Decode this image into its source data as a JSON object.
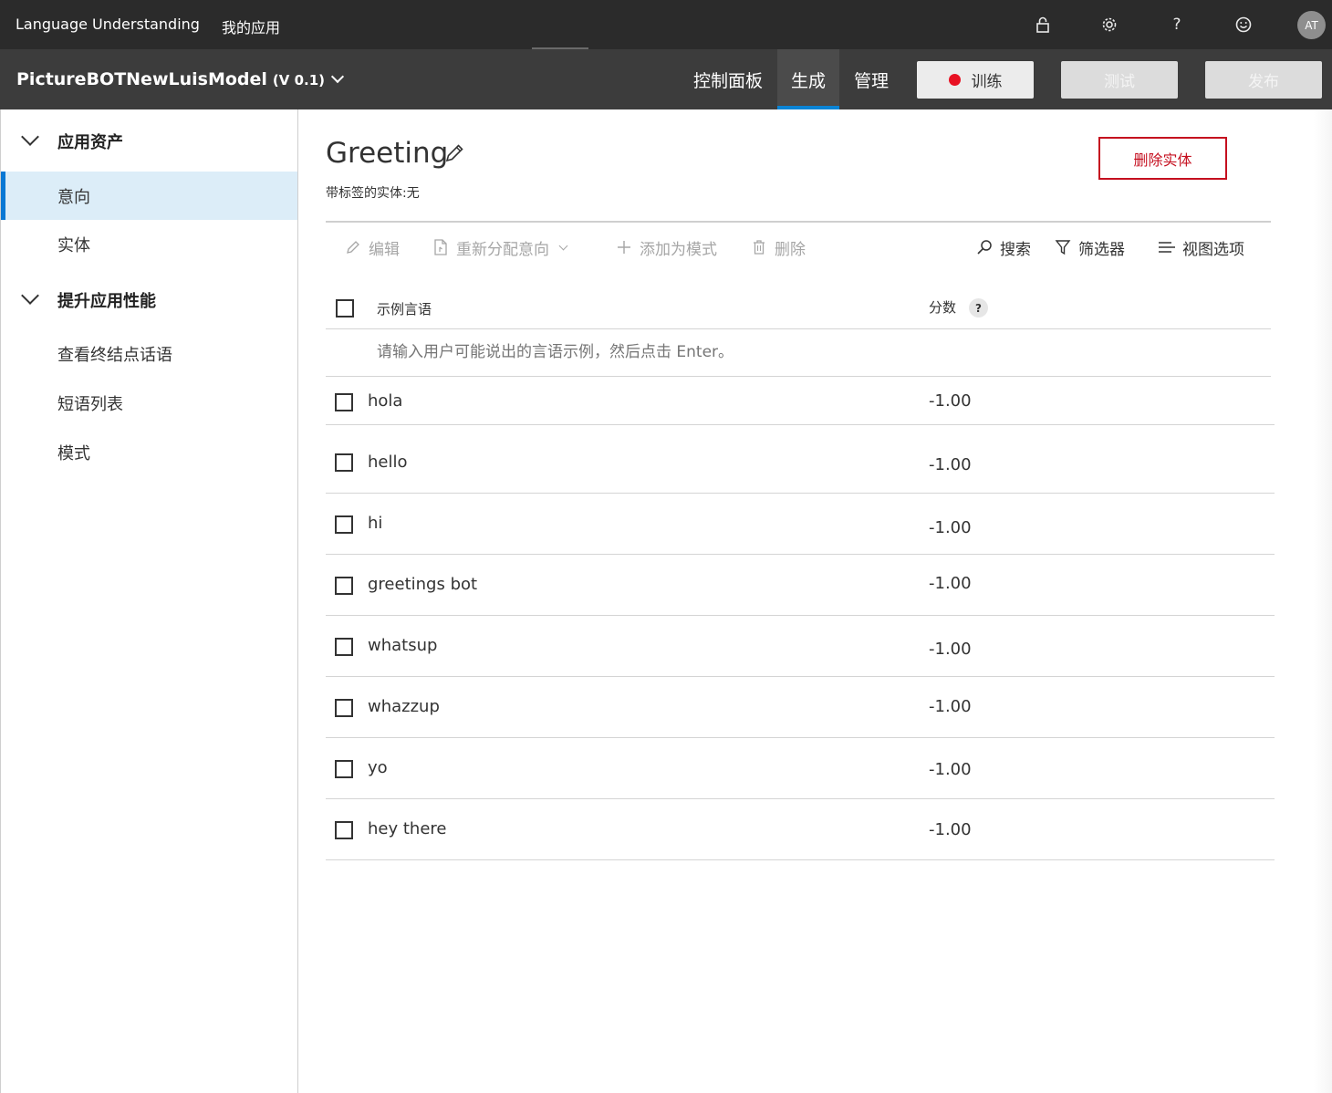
{
  "topbar": {
    "brand": "Language Understanding",
    "my_apps": "我的应用",
    "icons": [
      "lock-icon",
      "gear-icon",
      "help-icon",
      "smiley-icon"
    ],
    "avatar_initials": "AT"
  },
  "appbar": {
    "app_name": "PictureBOTNewLuisModel",
    "version": "(V 0.1)",
    "tabs": [
      {
        "label": "控制面板",
        "active": false
      },
      {
        "label": "生成",
        "active": true
      },
      {
        "label": "管理",
        "active": false
      }
    ],
    "train_label": "训练",
    "test_label": "测试",
    "publish_label": "发布"
  },
  "sidebar": {
    "groups": [
      {
        "label": "应用资产",
        "items": [
          {
            "label": "意向",
            "active": true
          },
          {
            "label": "实体",
            "active": false
          }
        ]
      },
      {
        "label": "提升应用性能",
        "items": [
          {
            "label": "查看终结点话语",
            "active": false
          },
          {
            "label": "短语列表",
            "active": false
          },
          {
            "label": "模式",
            "active": false
          }
        ]
      }
    ]
  },
  "main": {
    "title": "Greeting",
    "subtitle": "带标签的实体:无",
    "delete_entity_label": "删除实体",
    "toolbar": {
      "edit": "编辑",
      "reassign": "重新分配意向",
      "add_pattern": "添加为模式",
      "delete": "删除",
      "search": "搜索",
      "filter": "筛选器",
      "view_options": "视图选项"
    },
    "table": {
      "col_utterance": "示例言语",
      "col_score": "分数",
      "help": "?",
      "input_placeholder": "请输入用户可能说出的言语示例，然后点击 Enter。",
      "rows": [
        {
          "text": "hola",
          "score": "-1.00"
        },
        {
          "text": "hello",
          "score": "-1.00"
        },
        {
          "text": "hi",
          "score": "-1.00"
        },
        {
          "text": "greetings bot",
          "score": "-1.00"
        },
        {
          "text": "whatsup",
          "score": "-1.00"
        },
        {
          "text": "whazzup",
          "score": "-1.00"
        },
        {
          "text": "yo",
          "score": "-1.00"
        },
        {
          "text": "hey there",
          "score": "-1.00"
        }
      ]
    }
  },
  "colors": {
    "topbar_bg": "#2b2b2b",
    "appbar_bg": "#3c3c3c",
    "accent_blue": "#0a84d6",
    "danger_red": "#c50f1f",
    "train_dot": "#e81123",
    "sidebar_active_bg": "#dcedf8"
  }
}
